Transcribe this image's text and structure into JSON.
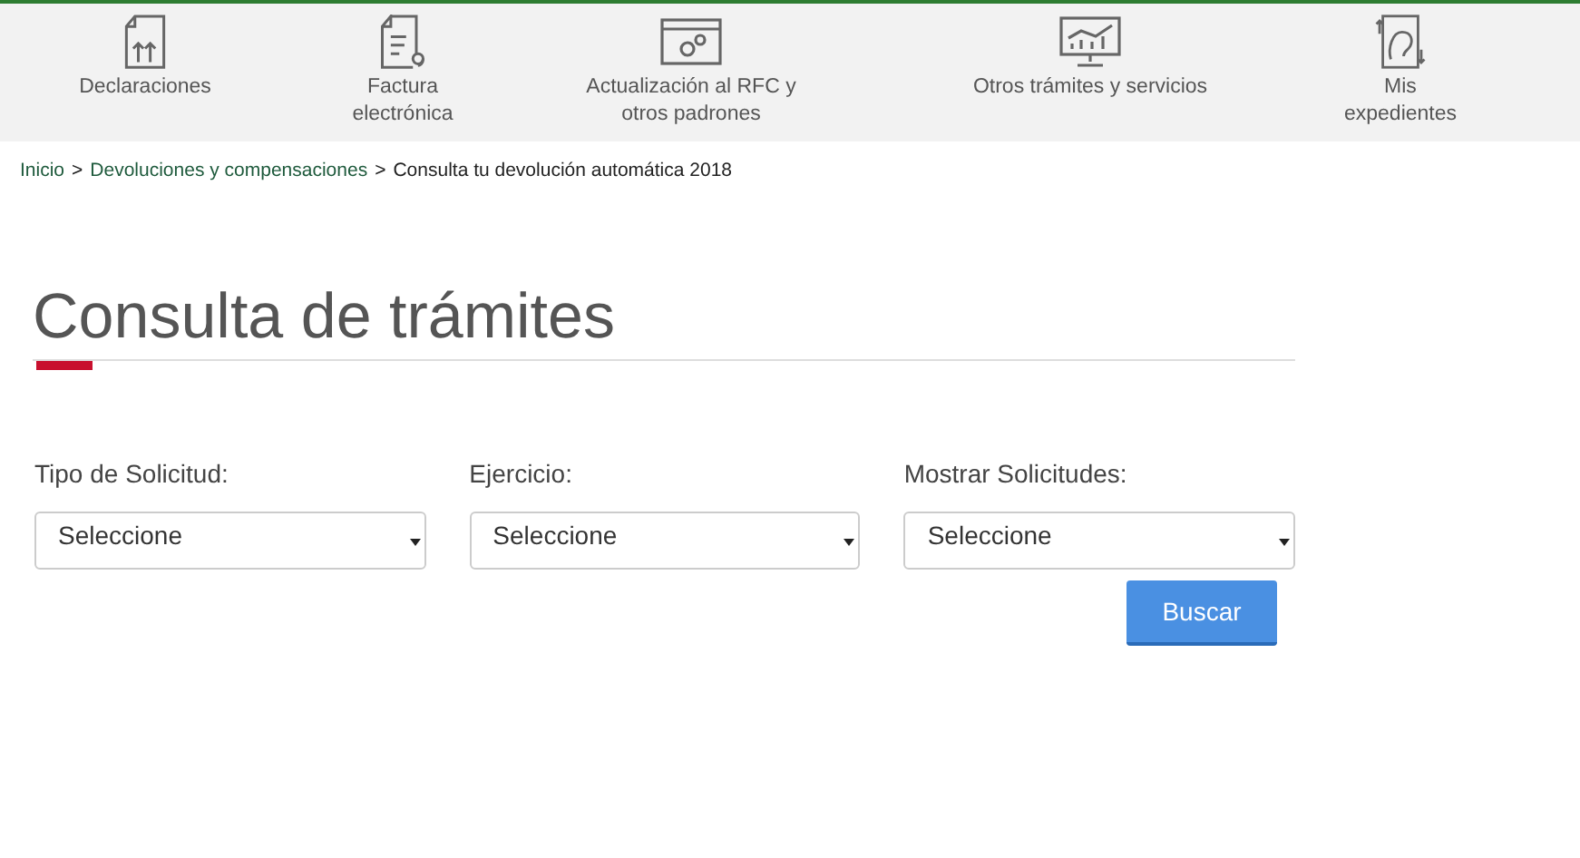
{
  "nav": [
    {
      "kind": "declarations",
      "label": "Declaraciones"
    },
    {
      "kind": "invoice",
      "label": "Factura electrónica"
    },
    {
      "kind": "settings",
      "label": "Actualización al RFC y otros padrones"
    },
    {
      "kind": "chart",
      "label": "Otros trámites y servicios"
    },
    {
      "kind": "profile",
      "label": "Mis expedientes"
    }
  ],
  "breadcrumb": [
    {
      "label": "Inicio",
      "link": true
    },
    {
      "label": "Devoluciones y compensaciones",
      "link": true
    },
    {
      "label": "Consulta tu devolución automática 2018",
      "link": false
    }
  ],
  "breadcrumb_separator": ">",
  "title": "Consulta de trámites",
  "filters": [
    {
      "label": "Tipo de Solicitud:",
      "value": "Seleccione"
    },
    {
      "label": "Ejercicio:",
      "value": "Seleccione"
    },
    {
      "label": "Mostrar Solicitudes:",
      "value": "Seleccione"
    }
  ],
  "search_button": "Buscar"
}
